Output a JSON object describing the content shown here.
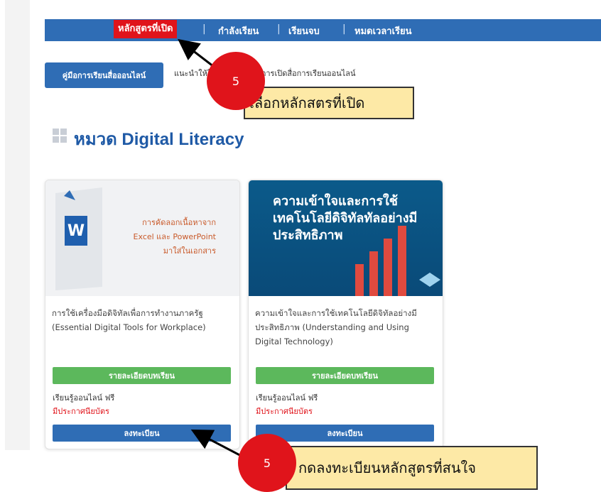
{
  "nav": {
    "items": [
      {
        "label": "หลักสูตรที่เปิด",
        "active": true
      },
      {
        "label": "กำลังเรียน"
      },
      {
        "label": "เรียนจบ"
      },
      {
        "label": "หมดเวลาเรียน"
      }
    ]
  },
  "guide": {
    "button_label": "คู่มือการเรียนสื่อออนไลน์",
    "text": "แนะนำให้ใช้ Chrome ในการเปิดสื่อการเรียนออนไลน์"
  },
  "section": {
    "title": "หมวด Digital Literacy"
  },
  "courses": [
    {
      "thumbnail_text": "การคัดลอกเนื้อหาจาก Excel และ PowerPoint มาใส่ในเอกสาร",
      "name": "การใช้เครื่องมือดิจิทัลเพื่อการทำงานภาครัฐ (Essential Digital Tools for Workplace)",
      "detail_label": "รายละเอียดบทเรียน",
      "free_label": "เรียนรู้ออนไลน์ ฟรี",
      "cert_label": "มีประกาศนียบัตร",
      "enroll_label": "ลงทะเบียน"
    },
    {
      "thumbnail_text": "ความเข้าใจและการใช้เทคโนโลยีดิจิทัลทัลอย่างมีประสิทธิภาพ",
      "name": "ความเข้าใจและการใช้เทคโนโลยีดิจิทัลอย่างมีประสิทธิภาพ (Understanding and Using Digital Technology)",
      "detail_label": "รายละเอียดบทเรียน",
      "free_label": "เรียนรู้ออนไลน์ ฟรี",
      "cert_label": "มีประกาศนียบัตร",
      "enroll_label": "ลงทะเบียน"
    }
  ],
  "annotations": [
    {
      "step": "5",
      "text": "เลือกหลักสตรที่เปิด"
    },
    {
      "step": "5",
      "text": "กดลงทะเบียนหลักสูตรที่สนใจ"
    }
  ],
  "colors": {
    "nav_bg": "#2f6db5",
    "highlight_red": "#e0141b",
    "detail_green": "#5cb85c",
    "callout_bg": "#fde9a6"
  }
}
